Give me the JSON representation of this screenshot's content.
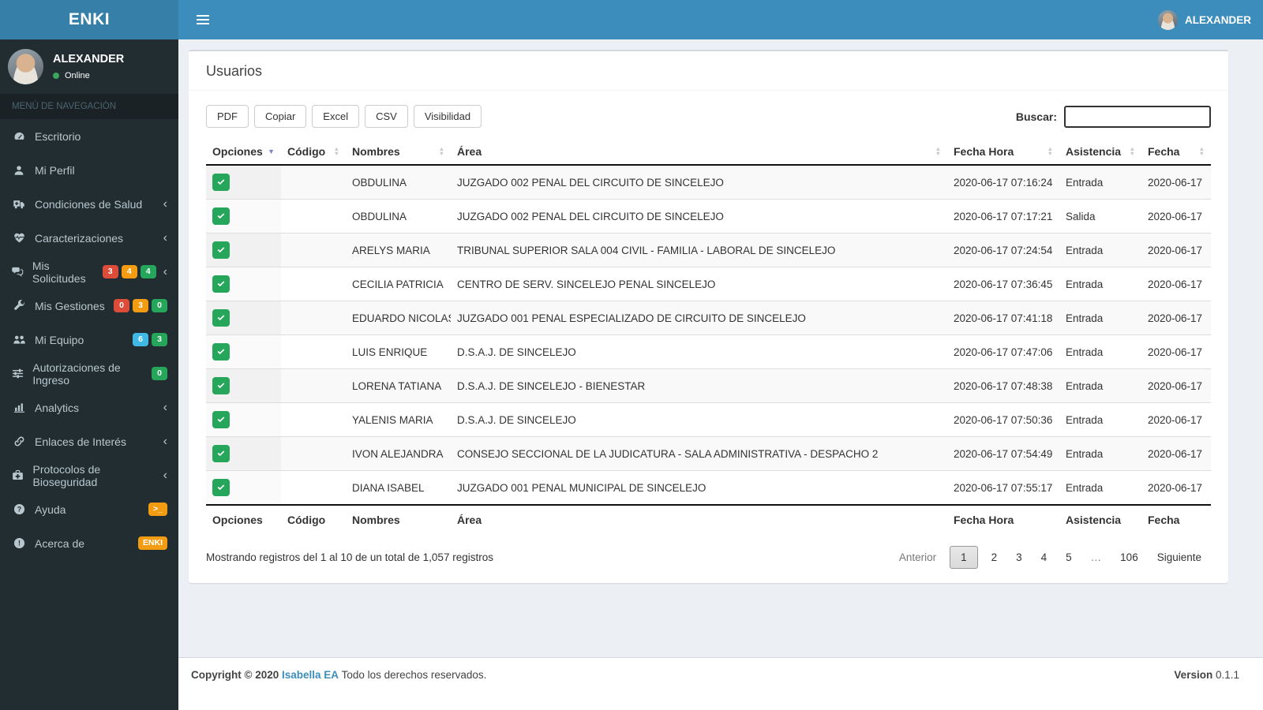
{
  "colors": {
    "navbar": "#3c8dbc",
    "brand_bg": "#367fa9",
    "sidebar": "#222d32",
    "check_green": "#26a65b",
    "badge_red": "#dd4b39",
    "badge_orange": "#f39c12",
    "badge_green": "#26a65b",
    "badge_blue": "#41b9e6",
    "sort_active": "#7d82c9"
  },
  "navbar": {
    "brand": "ENKI",
    "user": "ALEXANDER"
  },
  "sidebar": {
    "user": {
      "name": "ALEXANDER",
      "status": "Online"
    },
    "section_header": "MENÚ DE NAVEGACIÓN",
    "items": [
      {
        "name": "escritorio",
        "label": "Escritorio",
        "icon": "tachometer-icon",
        "badges": [],
        "chevron": false
      },
      {
        "name": "mi-perfil",
        "label": "Mi Perfil",
        "icon": "user-icon",
        "badges": [],
        "chevron": false
      },
      {
        "name": "condiciones-de-salud",
        "label": "Condiciones de Salud",
        "icon": "ambulance-icon",
        "badges": [],
        "chevron": true
      },
      {
        "name": "caracterizaciones",
        "label": "Caracterizaciones",
        "icon": "heartbeat-icon",
        "badges": [],
        "chevron": true
      },
      {
        "name": "mis-solicitudes",
        "label": "Mis Solicitudes",
        "icon": "comments-icon",
        "badges": [
          {
            "text": "3",
            "color": "#dd4b39"
          },
          {
            "text": "4",
            "color": "#f39c12"
          },
          {
            "text": "4",
            "color": "#26a65b"
          }
        ],
        "chevron": true
      },
      {
        "name": "mis-gestiones",
        "label": "Mis Gestiones",
        "icon": "wrench-icon",
        "badges": [
          {
            "text": "0",
            "color": "#dd4b39"
          },
          {
            "text": "3",
            "color": "#f39c12"
          },
          {
            "text": "0",
            "color": "#26a65b"
          }
        ],
        "chevron": false
      },
      {
        "name": "mi-equipo",
        "label": "Mi Equipo",
        "icon": "users-icon",
        "badges": [
          {
            "text": "6",
            "color": "#41b9e6"
          },
          {
            "text": "3",
            "color": "#26a65b"
          }
        ],
        "chevron": false
      },
      {
        "name": "autorizaciones-de-ingreso",
        "label": "Autorizaciones de Ingreso",
        "icon": "sliders-icon",
        "badges": [
          {
            "text": "0",
            "color": "#26a65b"
          }
        ],
        "chevron": false
      },
      {
        "name": "analytics",
        "label": "Analytics",
        "icon": "bar-chart-icon",
        "badges": [],
        "chevron": true
      },
      {
        "name": "enlaces-de-interes",
        "label": "Enlaces de Interés",
        "icon": "link-icon",
        "badges": [],
        "chevron": true
      },
      {
        "name": "protocolos-de-bioseguridad",
        "label": "Protocolos de Bioseguridad",
        "icon": "medkit-icon",
        "badges": [],
        "chevron": true
      },
      {
        "name": "ayuda",
        "label": "Ayuda",
        "icon": "question-circle-icon",
        "badges": [
          {
            "text": ">_",
            "color": "#f39c12"
          }
        ],
        "chevron": false
      },
      {
        "name": "acerca-de",
        "label": "Acerca de",
        "icon": "exclamation-circle-icon",
        "badges": [
          {
            "text": "ENKI",
            "color": "#f39c12"
          }
        ],
        "chevron": false
      }
    ]
  },
  "main": {
    "title": "Usuarios",
    "buttons": [
      "PDF",
      "Copiar",
      "Excel",
      "CSV",
      "Visibilidad"
    ],
    "search_label": "Buscar:",
    "search_value": "",
    "table": {
      "columns": [
        {
          "label": "Opciones",
          "sort": "desc",
          "key": "opciones"
        },
        {
          "label": "Código",
          "sort": "both",
          "key": "codigo"
        },
        {
          "label": "Nombres",
          "sort": "both",
          "key": "nombres"
        },
        {
          "label": "Área",
          "sort": "both",
          "key": "area"
        },
        {
          "label": "Fecha Hora",
          "sort": "both",
          "key": "fecha_hora"
        },
        {
          "label": "Asistencia",
          "sort": "both",
          "key": "asistencia"
        },
        {
          "label": "Fecha",
          "sort": "both",
          "key": "fecha"
        }
      ],
      "rows": [
        {
          "checked": true,
          "codigo": "",
          "nombres": "OBDULINA",
          "area": "JUZGADO 002 PENAL DEL CIRCUITO DE SINCELEJO",
          "fecha_hora": "2020-06-17 07:16:24",
          "asistencia": "Entrada",
          "fecha": "2020-06-17"
        },
        {
          "checked": true,
          "codigo": "",
          "nombres": "OBDULINA",
          "area": "JUZGADO 002 PENAL DEL CIRCUITO DE SINCELEJO",
          "fecha_hora": "2020-06-17 07:17:21",
          "asistencia": "Salida",
          "fecha": "2020-06-17"
        },
        {
          "checked": true,
          "codigo": "",
          "nombres": "ARELYS MARIA",
          "area": "TRIBUNAL SUPERIOR SALA 004 CIVIL - FAMILIA - LABORAL DE SINCELEJO",
          "fecha_hora": "2020-06-17 07:24:54",
          "asistencia": "Entrada",
          "fecha": "2020-06-17"
        },
        {
          "checked": true,
          "codigo": "",
          "nombres": "CECILIA PATRICIA",
          "area": "CENTRO DE SERV. SINCELEJO PENAL SINCELEJO",
          "fecha_hora": "2020-06-17 07:36:45",
          "asistencia": "Entrada",
          "fecha": "2020-06-17"
        },
        {
          "checked": true,
          "codigo": "",
          "nombres": "EDUARDO NICOLAS",
          "area": "JUZGADO 001 PENAL ESPECIALIZADO DE CIRCUITO DE SINCELEJO",
          "fecha_hora": "2020-06-17 07:41:18",
          "asistencia": "Entrada",
          "fecha": "2020-06-17"
        },
        {
          "checked": true,
          "codigo": "",
          "nombres": "LUIS ENRIQUE",
          "area": "D.S.A.J. DE SINCELEJO",
          "fecha_hora": "2020-06-17 07:47:06",
          "asistencia": "Entrada",
          "fecha": "2020-06-17"
        },
        {
          "checked": true,
          "codigo": "",
          "nombres": "LORENA TATIANA",
          "area": "D.S.A.J. DE SINCELEJO - BIENESTAR",
          "fecha_hora": "2020-06-17 07:48:38",
          "asistencia": "Entrada",
          "fecha": "2020-06-17"
        },
        {
          "checked": true,
          "codigo": "",
          "nombres": "YALENIS MARIA",
          "area": "D.S.A.J. DE SINCELEJO",
          "fecha_hora": "2020-06-17 07:50:36",
          "asistencia": "Entrada",
          "fecha": "2020-06-17"
        },
        {
          "checked": true,
          "codigo": "",
          "nombres": "IVON ALEJANDRA",
          "area": "CONSEJO SECCIONAL DE LA JUDICATURA - SALA ADMINISTRATIVA - DESPACHO 2",
          "fecha_hora": "2020-06-17 07:54:49",
          "asistencia": "Entrada",
          "fecha": "2020-06-17"
        },
        {
          "checked": true,
          "codigo": "",
          "nombres": "DIANA ISABEL",
          "area": "JUZGADO 001 PENAL MUNICIPAL DE SINCELEJO",
          "fecha_hora": "2020-06-17 07:55:17",
          "asistencia": "Entrada",
          "fecha": "2020-06-17"
        }
      ]
    },
    "info": "Mostrando registros del 1 al 10 de un total de 1,057 registros",
    "pagination": {
      "previous_label": "Anterior",
      "pages": [
        "1",
        "2",
        "3",
        "4",
        "5",
        "…",
        "106"
      ],
      "current_page": "1",
      "next_label": "Siguiente"
    }
  },
  "footer": {
    "copyright": "Copyright © 2020",
    "link_text": "Isabella EA",
    "rest": "Todo los derechos reservados.",
    "version_label": "Version",
    "version_value": "0.1.1"
  }
}
